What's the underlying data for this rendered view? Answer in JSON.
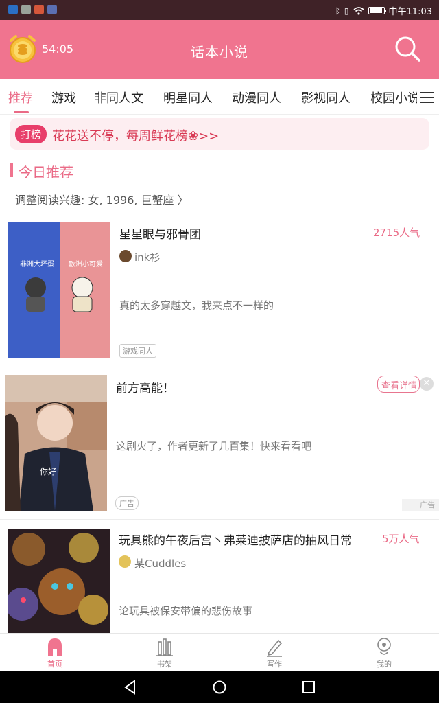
{
  "status_bar": {
    "time": "中午11:03",
    "battery_level": 0.9,
    "icons": [
      "bluetooth-icon",
      "vibrate-icon",
      "wifi-icon",
      "battery-icon"
    ],
    "notification_icons": [
      "app-notification-icon",
      "wechat-icon",
      "game-app-icon",
      "settings-app-icon"
    ]
  },
  "header": {
    "timer": "54:05",
    "title": "话本小说",
    "accent_color": "#f0748f"
  },
  "tabs": {
    "items": [
      "推荐",
      "游戏",
      "非同人文",
      "明星同人",
      "动漫同人",
      "影视同人",
      "校园小说"
    ],
    "active": "推荐"
  },
  "banner": {
    "badge": "打榜",
    "text": "花花送不停，每周鲜花榜❀>>"
  },
  "section": {
    "title": "今日推荐",
    "interest": "调整阅读兴趣: 女, 1996, 巨蟹座 〉"
  },
  "books": [
    {
      "title": "星星眼与邪骨团",
      "popularity": "2715人气",
      "author": "ink衫",
      "description": "真的太多穿越文，我来点不一样的",
      "tag": "游戏同人",
      "cover_text_left": "非洲大坏蛋",
      "cover_text_right": "欧洲小可爱"
    },
    {
      "title": "玩具熊的午夜后宫丶弗莱迪披萨店的抽风日常",
      "popularity": "5万人气",
      "author": "某Cuddles",
      "description": "论玩具被保安带偏的悲伤故事"
    }
  ],
  "ad": {
    "title": "前方高能！",
    "description": "这剧火了，作者更新了几百集！快来看看吧",
    "button": "查看详情",
    "tag": "广告",
    "corner": "广告",
    "image_caption": "你好"
  },
  "bottom_nav": {
    "items": [
      "首页",
      "书架",
      "写作",
      "我的"
    ],
    "active": "首页"
  }
}
